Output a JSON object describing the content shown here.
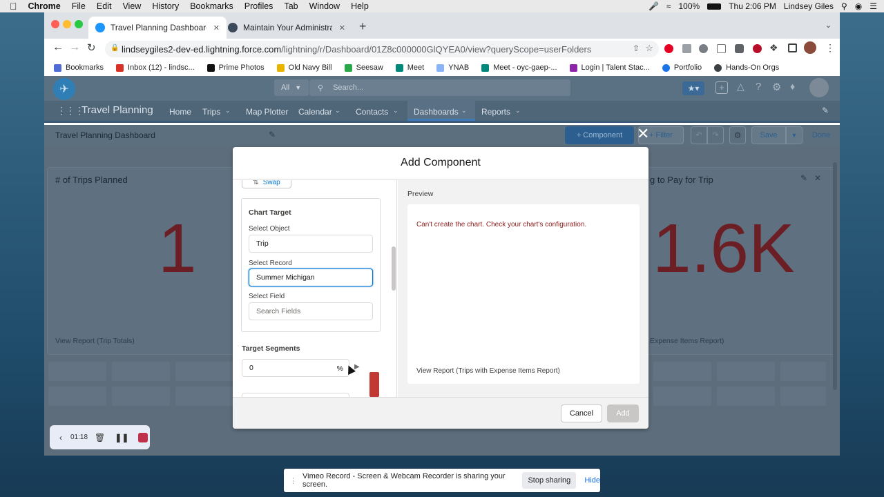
{
  "mac_menu": {
    "app": "Chrome",
    "items": [
      "File",
      "Edit",
      "View",
      "History",
      "Bookmarks",
      "Profiles",
      "Tab",
      "Window",
      "Help"
    ],
    "battery": "100%",
    "clock": "Thu 2:06 PM",
    "user": "Lindsey Giles"
  },
  "browser": {
    "tabs": [
      {
        "title": "Travel Planning Dashboard | Sa",
        "color": "#1b96ff"
      },
      {
        "title": "Maintain Your Administrator Ce",
        "color": "#3b4a5a"
      }
    ],
    "url_host": "lindseygiles2-dev-ed.lightning.force.com",
    "url_path": "/lightning/r/Dashboard/01Z8c000000GlQYEA0/view?queryScope=userFolders",
    "bookmarks": [
      {
        "label": "Bookmarks",
        "color": "#4f6bd6"
      },
      {
        "label": "Inbox (12) - lindsc...",
        "color": "#d93025"
      },
      {
        "label": "Prime Photos",
        "color": "#111111"
      },
      {
        "label": "Old Navy Bill",
        "color": "#e8b400"
      },
      {
        "label": "Seesaw",
        "color": "#2aa84a"
      },
      {
        "label": "Meet",
        "color": "#00897b"
      },
      {
        "label": "YNAB",
        "color": "#8ab4f8"
      },
      {
        "label": "Meet - oyc-gaep-...",
        "color": "#00897b"
      },
      {
        "label": "Login | Talent Stac...",
        "color": "#8e24aa"
      },
      {
        "label": "Portfolio",
        "color": "#1a73e8"
      },
      {
        "label": "Hands-On Orgs",
        "color": "#3c4043"
      }
    ]
  },
  "sf": {
    "search_scope": "All",
    "search_placeholder": "Search...",
    "app_name": "Travel Planning",
    "nav": [
      "Home",
      "Trips",
      "Map Plotter",
      "Calendar",
      "Contacts",
      "Dashboards",
      "Reports"
    ],
    "dashboard_title": "Travel Planning Dashboard",
    "toolbar": {
      "component": "+ Component",
      "filter": "+ Filter",
      "save": "Save",
      "done": "Done"
    },
    "cards": [
      {
        "title": "# of Trips Planned",
        "value": "1",
        "link": "View Report (Trip Totals)"
      },
      {
        "title": "g to Pay for Trip",
        "value": "1.6K",
        "link": "Expense Items Report)"
      }
    ]
  },
  "modal": {
    "title": "Add Component",
    "swap": "Swap",
    "chart_target": "Chart Target",
    "select_object_label": "Select Object",
    "select_object_value": "Trip",
    "select_record_label": "Select Record",
    "select_record_value": "Summer Michigan",
    "select_field_label": "Select Field",
    "select_field_placeholder": "Search Fields",
    "target_segments": "Target Segments",
    "segment_value": "0",
    "segment_unit": "%",
    "preview_label": "Preview",
    "error": "Can't create the chart. Check your chart's configuration.",
    "preview_link": "View Report (Trips with Expense Items Report)",
    "cancel": "Cancel",
    "add": "Add"
  },
  "recorder": {
    "time": "01:18"
  },
  "share_bar": {
    "message": "Vimeo Record - Screen & Webcam Recorder is sharing your screen.",
    "stop": "Stop sharing",
    "hide": "Hide"
  }
}
